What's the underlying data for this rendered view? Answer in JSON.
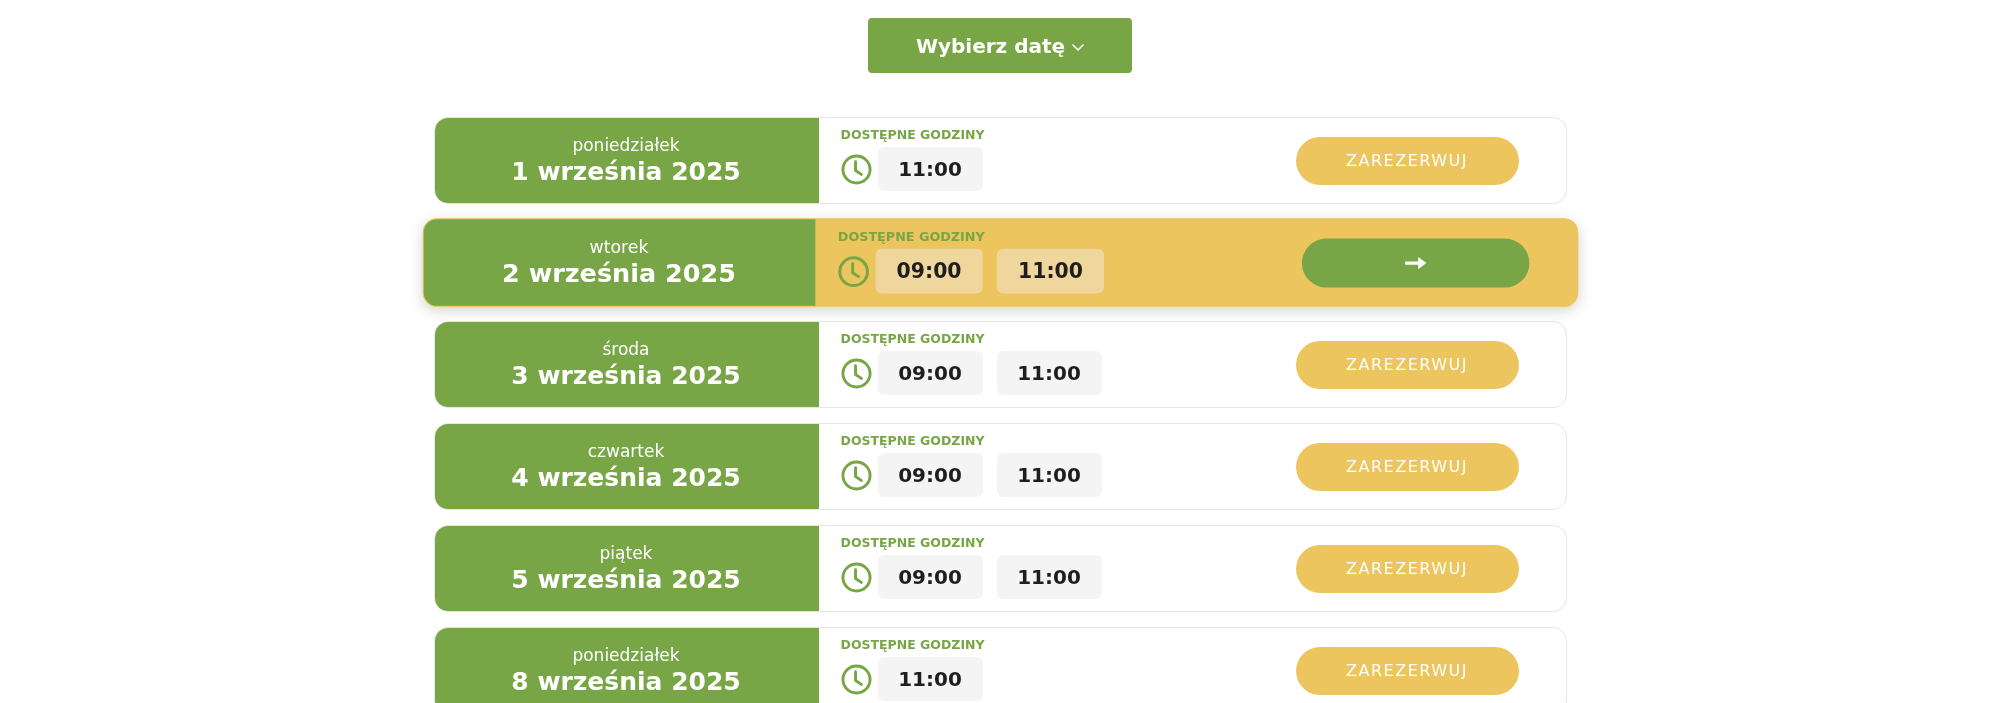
{
  "date_picker": {
    "label": "Wybierz datę"
  },
  "days": [
    {
      "weekday": "poniedziałek",
      "date": "1 września 2025",
      "heading": "DOSTĘPNE GODZINY",
      "times": [
        "11:00"
      ],
      "selected": false,
      "action": "ZAREZERWUJ"
    },
    {
      "weekday": "wtorek",
      "date": "2 września 2025",
      "heading": "DOSTĘPNE GODZINY",
      "times": [
        "09:00",
        "11:00"
      ],
      "selected": true
    },
    {
      "weekday": "środa",
      "date": "3 września 2025",
      "heading": "DOSTĘPNE GODZINY",
      "times": [
        "09:00",
        "11:00"
      ],
      "selected": false,
      "action": "ZAREZERWUJ"
    },
    {
      "weekday": "czwartek",
      "date": "4 września 2025",
      "heading": "DOSTĘPNE GODZINY",
      "times": [
        "09:00",
        "11:00"
      ],
      "selected": false,
      "action": "ZAREZERWUJ"
    },
    {
      "weekday": "piątek",
      "date": "5 września 2025",
      "heading": "DOSTĘPNE GODZINY",
      "times": [
        "09:00",
        "11:00"
      ],
      "selected": false,
      "action": "ZAREZERWUJ"
    },
    {
      "weekday": "poniedziałek",
      "date": "8 września 2025",
      "heading": "DOSTĘPNE GODZINY",
      "times": [
        "11:00"
      ],
      "selected": false,
      "action": "ZAREZERWUJ"
    }
  ]
}
